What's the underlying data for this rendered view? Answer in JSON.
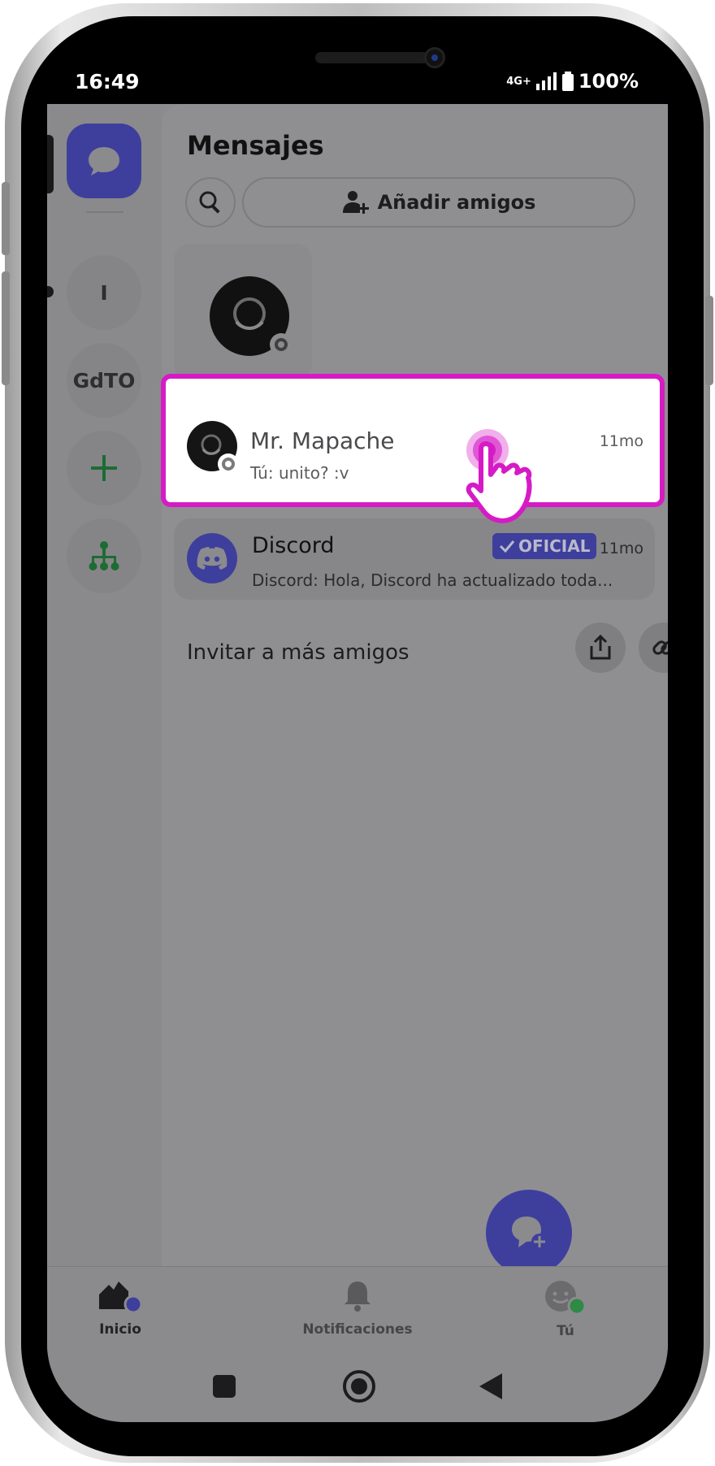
{
  "status_bar": {
    "time": "16:49",
    "network": "4G+",
    "battery": "100%"
  },
  "server_rail": {
    "items": [
      {
        "label": "I"
      },
      {
        "label": "GdTO"
      }
    ]
  },
  "messages": {
    "title": "Mensajes",
    "add_friends_label": "Añadir amigos",
    "conversations": [
      {
        "name": "Mr. Mapache",
        "preview": "Tú: unito? :v",
        "time": "11mo"
      },
      {
        "name": "Discord",
        "badge": "OFICIAL",
        "preview": "Discord: Hola, Discord ha actualizado toda...",
        "time": "11mo"
      }
    ],
    "invite_label": "Invitar a más amigos"
  },
  "bottom_nav": {
    "home": "Inicio",
    "notifications": "Notificaciones",
    "you": "Tú"
  },
  "colors": {
    "brand": "#3e3f9c",
    "highlight": "#d61bc6",
    "online_green": "#2e8a45"
  }
}
